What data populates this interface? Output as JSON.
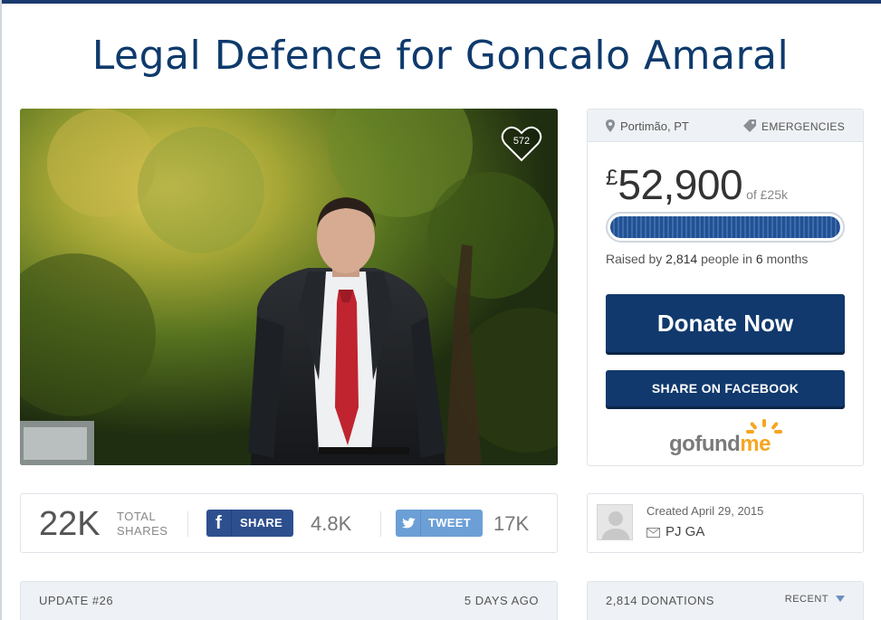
{
  "page": {
    "title": "Legal Defence for Goncalo Amaral"
  },
  "photo": {
    "heart_count": "572",
    "heart_icon": "heart-icon"
  },
  "campaign": {
    "location": "Portimão, PT",
    "location_icon": "map-pin-icon",
    "category": "EMERGENCIES",
    "category_icon": "tag-icon",
    "currency": "£",
    "raised": "52,900",
    "goal": "of £25k",
    "progress_fraction": 1.0,
    "raised_by_prefix": "Raised by ",
    "donor_count": "2,814",
    "raised_by_mid": " people in ",
    "duration": "6",
    "raised_by_suffix": " months",
    "donate_label": "Donate Now",
    "share_fb_label": "SHARE ON FACEBOOK",
    "brand_left": "gofund",
    "brand_right": "me",
    "brand_color": "#f5a623",
    "button_color": "#11396d"
  },
  "shares": {
    "total": "22K",
    "total_label_1": "TOTAL",
    "total_label_2": "SHARES",
    "fb_glyph": "f",
    "fb_label": "SHARE",
    "fb_count": "4.8K",
    "tw_label": "TWEET",
    "tw_count": "17K"
  },
  "creator": {
    "created": "Created April 29, 2015",
    "name": "PJ GA",
    "mail_icon": "envelope-icon"
  },
  "update": {
    "label": "UPDATE #26",
    "time": "5 DAYS AGO"
  },
  "donations": {
    "count_label": "2,814 DONATIONS",
    "sort_label": "RECENT"
  }
}
